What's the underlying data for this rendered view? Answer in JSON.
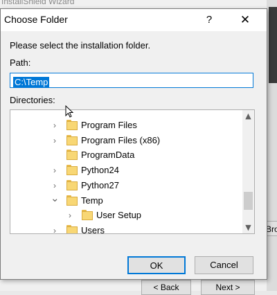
{
  "background_window": {
    "title": "InstallShield Wizard",
    "browse_label": "Bro",
    "back_label": "< Back",
    "next_label": "Next >"
  },
  "dialog": {
    "title": "Choose Folder",
    "help_label": "?",
    "close_label": "✕",
    "instruction": "Please select the installation folder.",
    "path_label": "Path:",
    "path_value": "C:\\Temp",
    "directories_label": "Directories:",
    "tree": [
      {
        "label": "Program Files",
        "chevron": "›",
        "level": 0
      },
      {
        "label": "Program Files (x86)",
        "chevron": "›",
        "level": 0
      },
      {
        "label": "ProgramData",
        "chevron": "",
        "level": 0
      },
      {
        "label": "Python24",
        "chevron": "›",
        "level": 0
      },
      {
        "label": "Python27",
        "chevron": "›",
        "level": 0
      },
      {
        "label": "Temp",
        "chevron": "⌄",
        "level": 0
      },
      {
        "label": "User Setup",
        "chevron": "›",
        "level": 1
      },
      {
        "label": "Users",
        "chevron": "›",
        "level": 0
      }
    ],
    "ok_label": "OK",
    "cancel_label": "Cancel"
  },
  "colors": {
    "accent": "#0078d7",
    "folder": "#f8d775"
  }
}
